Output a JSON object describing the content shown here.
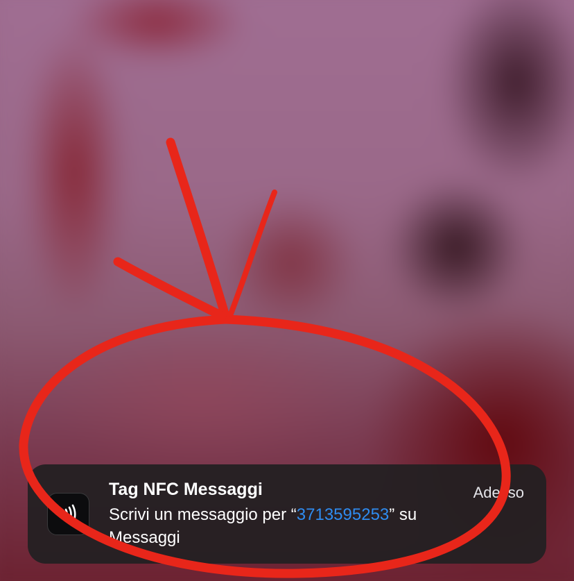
{
  "notification": {
    "app_icon": "nfc-icon",
    "title": "Tag NFC Messaggi",
    "time": "Adesso",
    "body_prefix": "Scrivi un messaggio per “",
    "phone_number": "3713595253",
    "body_suffix": "” su",
    "body_line2": "Messaggi"
  },
  "annotation": {
    "type": "arrow-and-circle",
    "color": "#e8261a"
  },
  "colors": {
    "link_blue": "#2f8cf0",
    "annotation_red": "#e8261a",
    "banner_bg": "#232022"
  }
}
